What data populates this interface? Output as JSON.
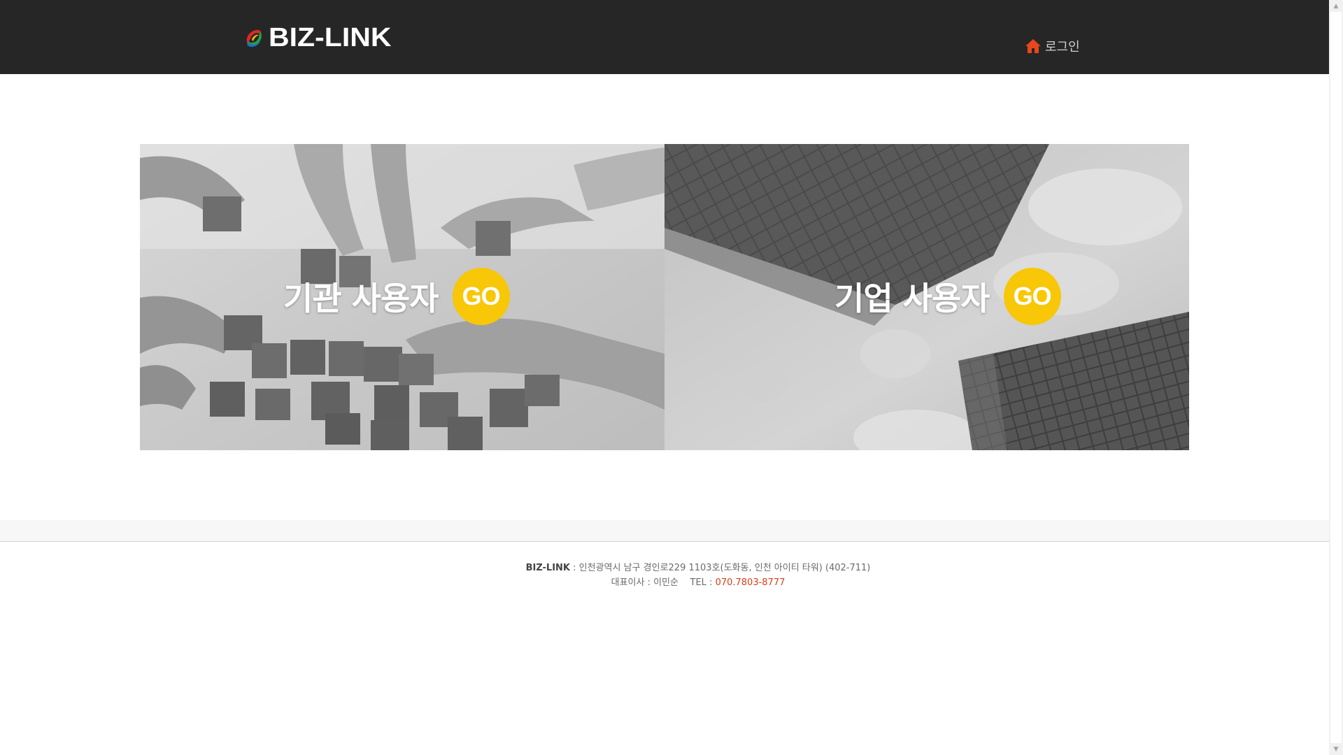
{
  "header": {
    "logo_text": "BIZ-LINK",
    "login_label": "로그인",
    "login_icon": "home-icon",
    "login_icon_color": "#e8461c",
    "background": "#262626"
  },
  "banners": [
    {
      "label": "기관 사용자",
      "go_label": "GO",
      "image": "hands-building-blocks-photo"
    },
    {
      "label": "기업 사용자",
      "go_label": "GO",
      "image": "glass-skyscrapers-photo"
    }
  ],
  "go_color": "#f7c708",
  "footer": {
    "brand": "BIZ-LINK",
    "address": " : 인천광역시 남구 경인로229 1103호(도화동, 인천 아이티 타워) (402-711)",
    "ceo": "대표이사 : 이민순",
    "tel_label": "TEL : ",
    "tel": "070.7803-8777",
    "tel_color": "#d9401a"
  }
}
